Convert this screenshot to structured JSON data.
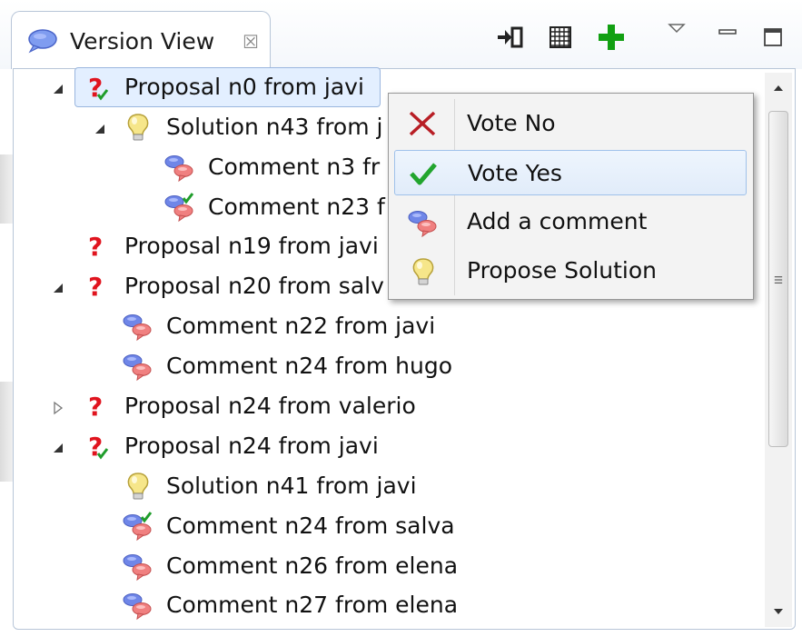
{
  "view": {
    "tab_title": "Version View",
    "tab_icon": "speech-bubble-icon",
    "close_glyph": "☒",
    "toolbar": [
      {
        "name": "collapse-all-icon"
      },
      {
        "name": "grid-icon"
      },
      {
        "name": "add-icon"
      },
      {
        "name": "view-menu-icon"
      },
      {
        "name": "minimize-icon"
      },
      {
        "name": "maximize-icon"
      }
    ]
  },
  "tree": [
    {
      "label": "Proposal n0 from javi",
      "icon": "proposal-voted-icon",
      "twisty": "expanded",
      "selected": true
    },
    {
      "label": "Solution n43 from j",
      "icon": "solution-bulb-icon",
      "twisty": "expanded"
    },
    {
      "label": "Comment n3 fr",
      "icon": "comment-icon",
      "twisty": "none"
    },
    {
      "label": "Comment n23 f",
      "icon": "comment-voted-icon",
      "twisty": "none"
    },
    {
      "label": "Proposal n19 from javi",
      "icon": "proposal-icon",
      "twisty": "none"
    },
    {
      "label": "Proposal n20 from salv",
      "icon": "proposal-icon",
      "twisty": "expanded"
    },
    {
      "label": "Comment n22 from javi",
      "icon": "comment-icon",
      "twisty": "none"
    },
    {
      "label": "Comment n24 from hugo",
      "icon": "comment-icon",
      "twisty": "none"
    },
    {
      "label": "Proposal n24 from valerio",
      "icon": "proposal-icon",
      "twisty": "collapsed"
    },
    {
      "label": "Proposal n24 from javi",
      "icon": "proposal-voted-icon",
      "twisty": "expanded"
    },
    {
      "label": "Solution n41 from javi",
      "icon": "solution-bulb-icon",
      "twisty": "none"
    },
    {
      "label": "Comment n24 from salva",
      "icon": "comment-voted-icon",
      "twisty": "none"
    },
    {
      "label": "Comment n26 from elena",
      "icon": "comment-icon",
      "twisty": "none"
    },
    {
      "label": "Comment n27 from elena",
      "icon": "comment-icon",
      "twisty": "none"
    }
  ],
  "context_menu": {
    "items": [
      {
        "label": "Vote No",
        "icon": "red-x-icon"
      },
      {
        "label": "Vote Yes",
        "icon": "green-check-icon",
        "highlighted": true
      },
      {
        "label": "Add a comment",
        "icon": "comment-icon"
      },
      {
        "label": "Propose Solution",
        "icon": "solution-bulb-icon"
      }
    ]
  },
  "colors": {
    "question_red": "#e0141e",
    "check_green": "#1f9d2b",
    "add_green": "#12a012",
    "bubble_blue": "#6f86e8",
    "bubble_pink": "#f08080",
    "bulb_yellow": "#f6e68a",
    "selection_bg": "#e3efff"
  }
}
